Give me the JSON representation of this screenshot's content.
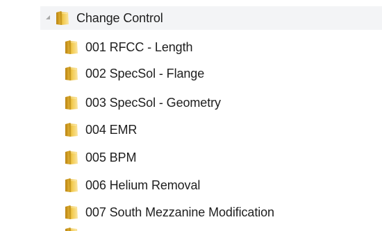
{
  "tree": {
    "parent": {
      "label": "Change Control",
      "expander_icon": "triangle-expanded-icon",
      "icon": "folder-icon"
    },
    "children": [
      {
        "label": "001 RFCC - Length",
        "icon": "folder-icon"
      },
      {
        "label": "002 SpecSol - Flange",
        "icon": "folder-icon"
      },
      {
        "label": "003 SpecSol - Geometry",
        "icon": "folder-icon"
      },
      {
        "label": "004 EMR",
        "icon": "folder-icon"
      },
      {
        "label": "005 BPM",
        "icon": "folder-icon"
      },
      {
        "label": "006 Helium Removal",
        "icon": "folder-icon"
      },
      {
        "label": "007 South Mezzanine Modification",
        "icon": "folder-icon"
      }
    ]
  },
  "colors": {
    "selection_background": "#f3f4f6",
    "folder_light": "#fde9a6",
    "folder_main": "#f2c94c",
    "folder_dark": "#c99516",
    "text": "#1e1e1e"
  }
}
